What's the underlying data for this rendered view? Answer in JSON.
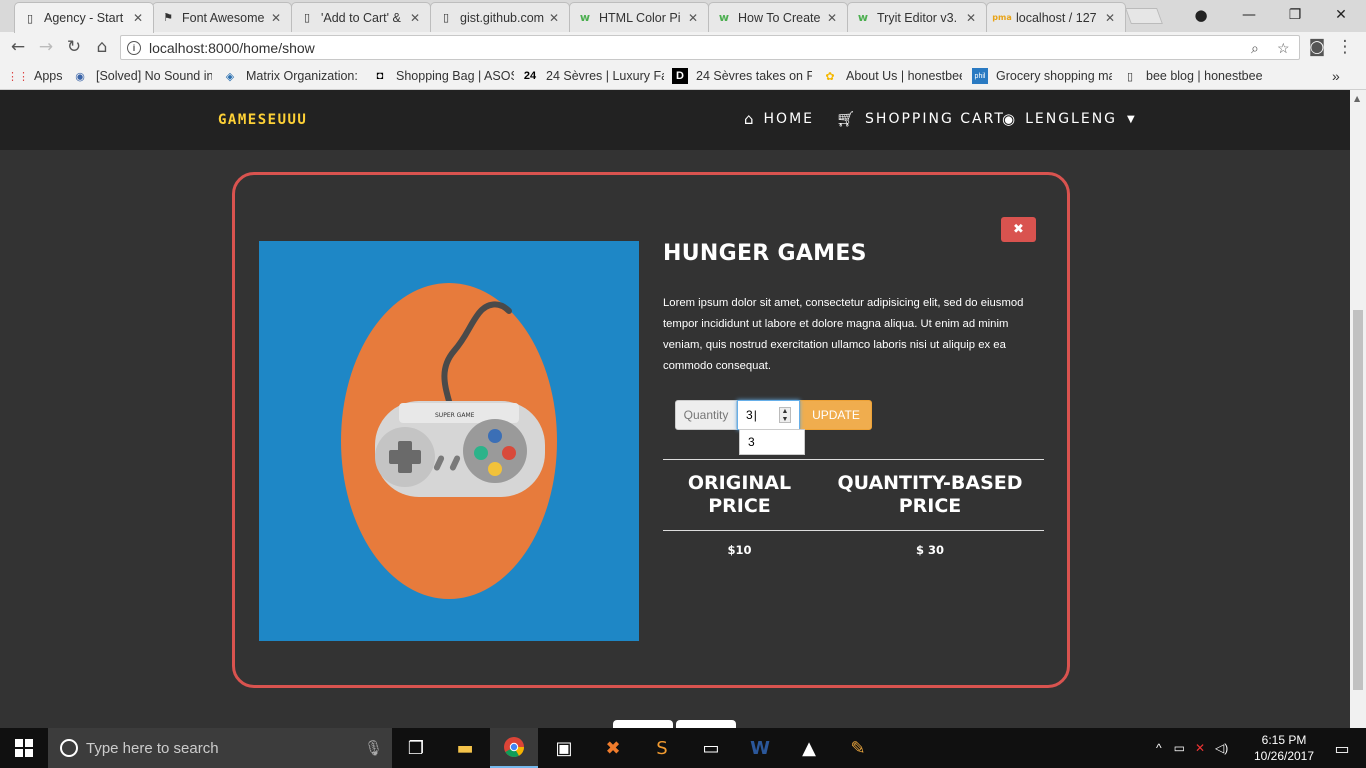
{
  "browser": {
    "tabs": [
      {
        "title": "Agency - Start",
        "icon": "page-icon",
        "active": true
      },
      {
        "title": "Font Awesome",
        "icon": "flag-icon"
      },
      {
        "title": "'Add to Cart' &",
        "icon": "page-icon"
      },
      {
        "title": "gist.github.com",
        "icon": "page-icon"
      },
      {
        "title": "HTML Color Pi",
        "icon": "w3-icon"
      },
      {
        "title": "How To Create",
        "icon": "w3-icon"
      },
      {
        "title": "Tryit Editor v3.",
        "icon": "w3-icon"
      },
      {
        "title": "localhost / 127",
        "icon": "pma-icon"
      }
    ],
    "url": "localhost:8000/home/show",
    "bookmarks": [
      {
        "label": "Apps",
        "icon": "apps-grid-icon"
      },
      {
        "label": "[Solved] No Sound in",
        "icon": "forum-icon"
      },
      {
        "label": "Matrix Organization:",
        "icon": "matrix-icon"
      },
      {
        "label": "Shopping Bag | ASOS",
        "icon": "asos-icon"
      },
      {
        "label": "24 Sèvres | Luxury Fas",
        "icon": "sevres-icon"
      },
      {
        "label": "24 Sèvres takes on Fa",
        "icon": "d-icon"
      },
      {
        "label": "About Us | honestbee",
        "icon": "bee-icon"
      },
      {
        "label": "Grocery shopping ma",
        "icon": "phil-icon"
      },
      {
        "label": "bee blog | honestbee",
        "icon": "page-icon"
      }
    ]
  },
  "site": {
    "brand": "GAMESEUUU",
    "nav": [
      {
        "label": "HOME",
        "icon": "home-icon"
      },
      {
        "label": "SHOPPING CART",
        "icon": "cart-icon"
      },
      {
        "label": "LENGLENG",
        "icon": "user-circle-icon"
      }
    ]
  },
  "product": {
    "title": "HUNGER GAMES",
    "description": "Lorem ipsum dolor sit amet, consectetur adipisicing elit, sed do eiusmod tempor incididunt ut labore et dolore magna aliqua. Ut enim ad minim veniam, quis nostrud exercitation ullamco laboris nisi ut aliquip ex ea commodo consequat.",
    "image_caption": "SUPER GAME",
    "colors": {
      "image_bg": "#1e87c6",
      "circle": "#e77b3c",
      "border": "#d9534f"
    },
    "quantity_label": "Quantity",
    "quantity_value": "3",
    "autocomplete_value": "3",
    "update_label": "UPDATE",
    "close_label": "✖",
    "table": {
      "headers": [
        "ORIGINAL PRICE",
        "QUANTITY-BASED PRICE"
      ],
      "rows": [
        [
          "$10",
          "$ 30"
        ]
      ]
    }
  },
  "taskbar": {
    "search_placeholder": "Type here to search",
    "time": "6:15 PM",
    "date": "10/26/2017"
  }
}
